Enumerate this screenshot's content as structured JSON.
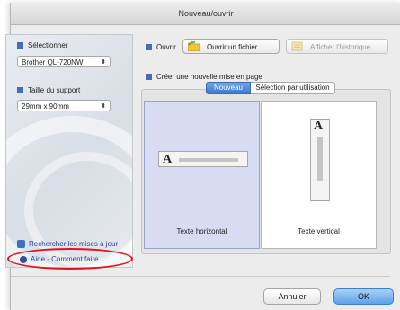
{
  "window": {
    "title": "Nouveau/ouvrir"
  },
  "sidebar": {
    "printer_label": "Sélectionner",
    "printer_value": "Brother QL-720NW",
    "media_label": "Taille du support",
    "media_value": "29mm x 90mm",
    "update_link": "Rechercher les mises à jour",
    "help_link": "Aide - Comment faire"
  },
  "open_section": {
    "label": "Ouvrir",
    "open_file_button": "Ouvrir un fichier",
    "history_button": "Afficher l'historique"
  },
  "create_section": {
    "label": "Créer une nouvelle mise en page",
    "tabs": [
      "Nouveau",
      "Sélection par utilisation"
    ],
    "active_tab": "Nouveau",
    "options": [
      {
        "label": "Texte horizontal",
        "selected": true
      },
      {
        "label": "Texte vertical",
        "selected": false
      }
    ]
  },
  "footer": {
    "cancel_button": "Annuler",
    "ok_button": "OK"
  },
  "colors": {
    "accent": "#4a6cb5",
    "highlight": "#e0151b",
    "selection": "#d8dcf2"
  }
}
